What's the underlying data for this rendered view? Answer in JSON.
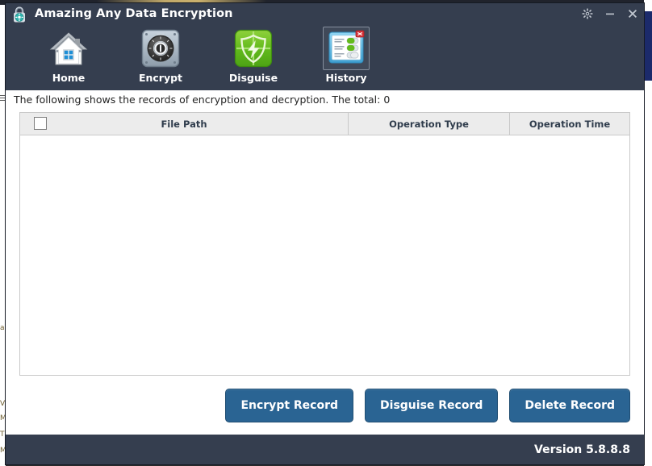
{
  "window": {
    "title": "Amazing Any Data Encryption",
    "app_icon": "padlock-icon",
    "controls": [
      {
        "name": "settings-gear",
        "icon": "gear-icon",
        "label": "Settings"
      },
      {
        "name": "minimize",
        "icon": "minimize-icon",
        "label": "Minimize"
      },
      {
        "name": "close",
        "icon": "close-icon",
        "label": "Close"
      }
    ]
  },
  "toolbar": {
    "items": [
      {
        "label": "Home",
        "icon": "home-icon",
        "selected": false
      },
      {
        "label": "Encrypt",
        "icon": "safe-dial-icon",
        "selected": false
      },
      {
        "label": "Disguise",
        "icon": "shield-bolt-icon",
        "selected": false
      },
      {
        "label": "History",
        "icon": "history-window-icon",
        "selected": true
      }
    ]
  },
  "main": {
    "info_text": "The following shows the records of encryption and decryption. The total: 0",
    "table": {
      "select_all_checked": false,
      "columns": [
        "File Path",
        "Operation Type",
        "Operation Time"
      ],
      "rows": []
    },
    "buttons": [
      {
        "label": "Encrypt Record",
        "name": "encrypt-record-button"
      },
      {
        "label": "Disguise Record",
        "name": "disguise-record-button"
      },
      {
        "label": "Delete Record",
        "name": "delete-record-button"
      }
    ]
  },
  "footer": {
    "version": "Version 5.8.8.8"
  },
  "colors": {
    "titlebar": "#353e4f",
    "button_blue": "#2a6493",
    "table_header": "#ececec",
    "accent_teal": "#2fb3ae",
    "disguise_green": "#62bb1f"
  }
}
